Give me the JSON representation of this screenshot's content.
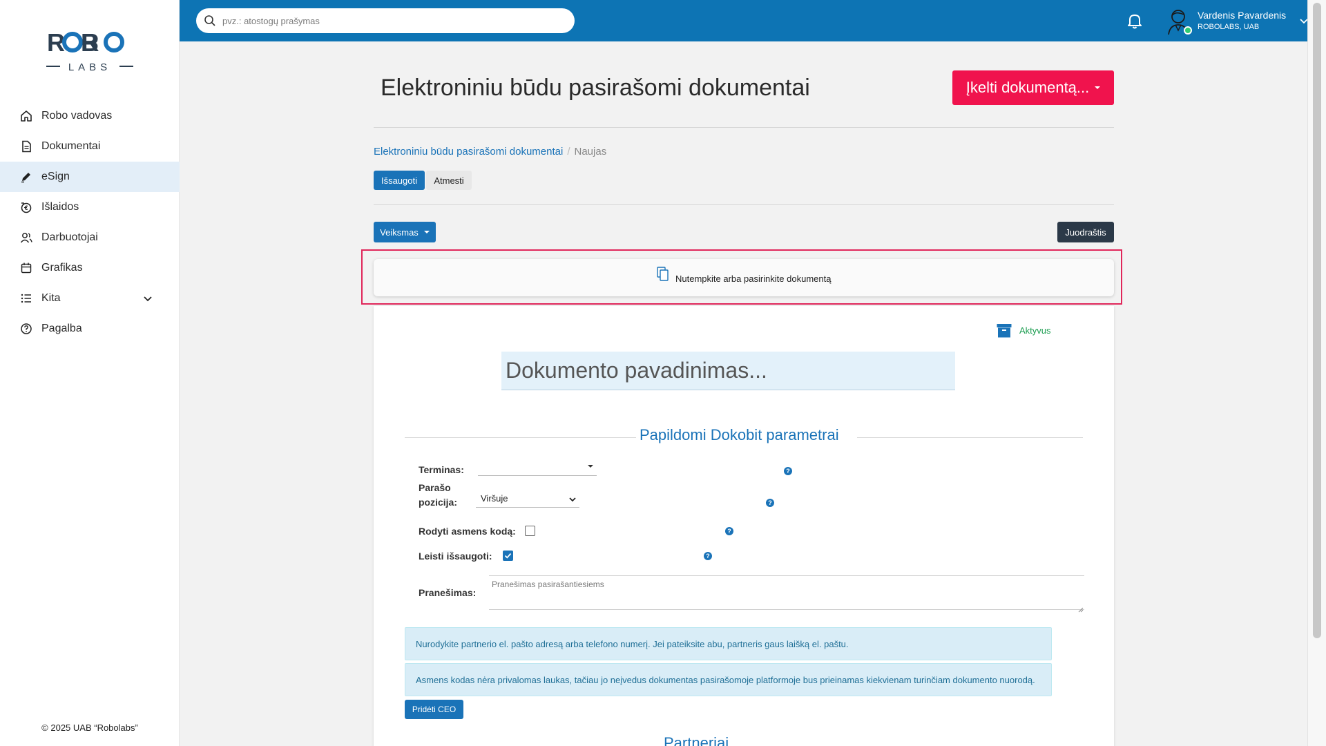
{
  "sidebar": {
    "logo_top": "ROBO",
    "logo_bottom": "LABS",
    "items": [
      {
        "label": "Robo vadovas",
        "icon": "home-icon"
      },
      {
        "label": "Dokumentai",
        "icon": "document-icon"
      },
      {
        "label": "eSign",
        "icon": "pen-icon",
        "active": true
      },
      {
        "label": "Išlaidos",
        "icon": "expenses-icon"
      },
      {
        "label": "Darbuotojai",
        "icon": "users-icon"
      },
      {
        "label": "Grafikas",
        "icon": "calendar-icon"
      },
      {
        "label": "Kita",
        "icon": "list-icon",
        "expandable": true
      },
      {
        "label": "Pagalba",
        "icon": "help-icon"
      }
    ],
    "copyright": "© 2025 UAB “Robolabs”"
  },
  "topbar": {
    "search_placeholder": "pvz.: atostogų prašymas",
    "user_name": "Vardenis Pavardenis",
    "user_company": "ROBOLABS, UAB"
  },
  "page": {
    "title": "Elektroniniu būdu pasirašomi dokumentai",
    "upload_button": "Įkelti dokumentą...",
    "breadcrumb": {
      "link": "Elektroniniu būdu pasirašomi dokumentai",
      "sep": "/",
      "current": "Naujas"
    },
    "save_button": "Išsaugoti",
    "cancel_button": "Atmesti",
    "action_button": "Veiksmas",
    "draft_button": "Juodraštis",
    "drop_text": "Nutempkite arba pasirinkite dokumentą"
  },
  "form": {
    "status": "Aktyvus",
    "title_placeholder": "Dokumento pavadinimas...",
    "section_title": "Papildomi Dokobit parametrai",
    "term_label": "Terminas:",
    "term_value": "",
    "position_label_1": "Parašo",
    "position_label_2": "pozicija:",
    "position_value": "Viršuje",
    "show_code_label": "Rodyti asmens kodą:",
    "show_code_checked": false,
    "allow_save_label": "Leisti išsaugoti:",
    "allow_save_checked": true,
    "message_label": "Pranešimas:",
    "message_placeholder": "Pranešimas pasirašantiesiems",
    "help_glyph": "?",
    "alert_1": "Nurodykite partnerio el. pašto adresą arba telefono numerį. Jei pateiksite abu, partneris gaus laišką el. paštu.",
    "alert_2": "Asmens kodas nėra privalomas laukas, tačiau jo neįvedus dokumentas pasirašomoje platformoje bus prieinamas kiekvienam turinčiam dokumento nuorodą.",
    "add_ceo_button": "Pridėti CEO",
    "partial_heading": "Partneriai..."
  },
  "colors": {
    "topbar": "#0d74b4",
    "primary": "#1a73b8",
    "upload": "#f0134d",
    "draft": "#2b3948",
    "status_active": "#1e9e52"
  }
}
